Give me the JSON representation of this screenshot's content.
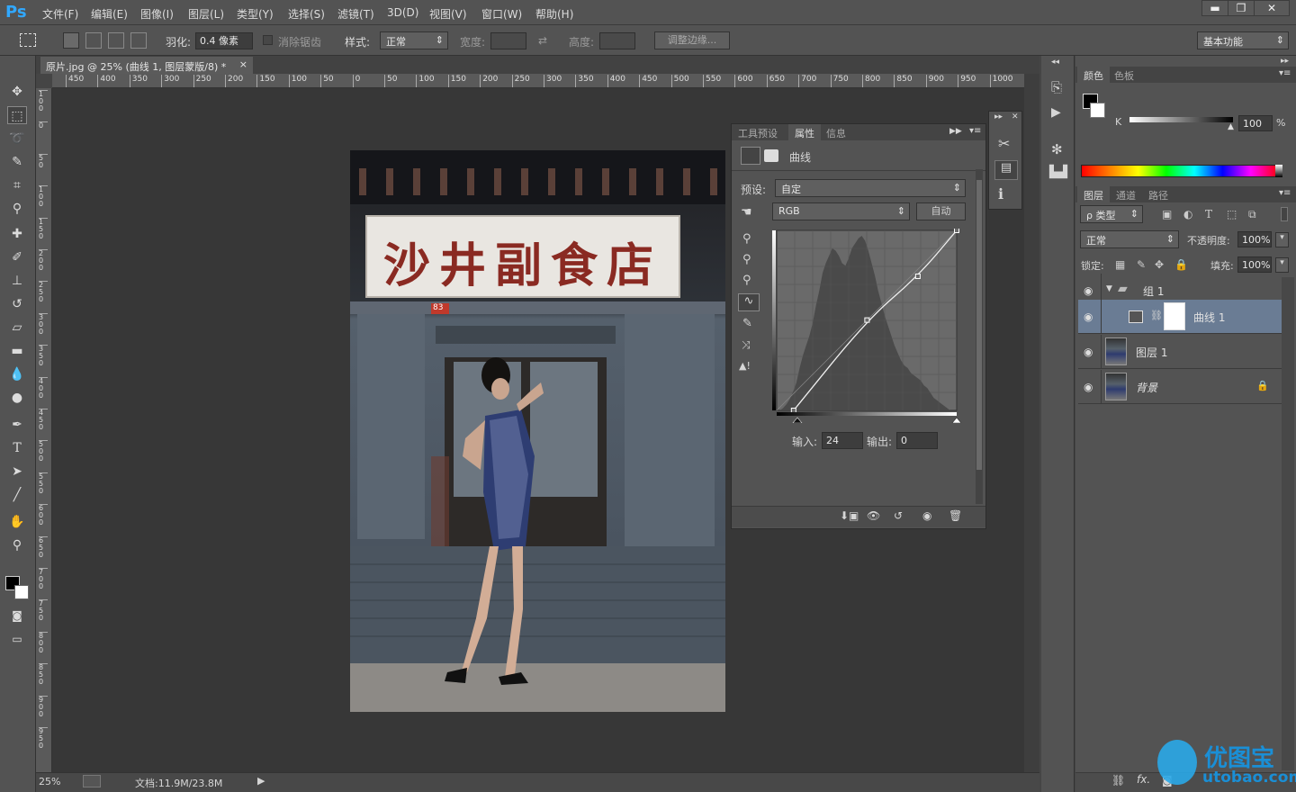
{
  "app": {
    "logo": "Ps"
  },
  "menu": [
    "文件(F)",
    "编辑(E)",
    "图像(I)",
    "图层(L)",
    "类型(Y)",
    "选择(S)",
    "滤镜(T)",
    "3D(D)",
    "视图(V)",
    "窗口(W)",
    "帮助(H)"
  ],
  "window_controls": {
    "minimize": "▬",
    "restore": "❐",
    "close": "✕"
  },
  "options": {
    "feather_label": "羽化:",
    "feather_value": "0.4 像素",
    "antialias_label": "消除锯齿",
    "style_label": "样式:",
    "style_value": "正常",
    "width_label": "宽度:",
    "height_label": "高度:",
    "refine_edge": "调整边缘...",
    "workspace": "基本功能"
  },
  "document": {
    "tab_title": "原片.jpg @ 25% (曲线 1, 图层蒙版/8) *",
    "close": "×",
    "zoom": "25%",
    "doc_size": "文档:11.9M/23.8M"
  },
  "rulers": {
    "h_ticks": [
      "450",
      "400",
      "350",
      "300",
      "250",
      "200",
      "150",
      "100",
      "50",
      "0",
      "50",
      "100",
      "150",
      "200",
      "250",
      "300",
      "350",
      "400",
      "450",
      "500",
      "550",
      "600",
      "650",
      "700",
      "750",
      "800",
      "850",
      "900",
      "950",
      "1000"
    ],
    "v_ticks": [
      "1 0 0",
      "0",
      "5 0",
      "1 0 0",
      "1 5 0",
      "2 0 0",
      "2 5 0",
      "3 0 0",
      "3 5 0",
      "4 0 0",
      "4 5 0",
      "5 0 0",
      "5 5 0",
      "6 0 0",
      "6 5 0",
      "7 0 0",
      "7 5 0",
      "8 0 0",
      "8 5 0",
      "9 0 0",
      "9 5 0"
    ]
  },
  "photo": {
    "sign_text": "沙井副食店",
    "door_number": "83"
  },
  "properties": {
    "tabs": [
      "工具预设",
      "属性",
      "信息"
    ],
    "active_tab": "属性",
    "adjustment_title": "曲线",
    "preset_label": "预设:",
    "preset_value": "自定",
    "channel": "RGB",
    "auto_button": "自动",
    "input_label": "输入:",
    "input_value": "24",
    "output_label": "输出:",
    "output_value": "0",
    "curve_points": [
      [
        24,
        0
      ],
      [
        128,
        128
      ],
      [
        200,
        190
      ],
      [
        255,
        255
      ]
    ],
    "histogram": [
      0,
      0,
      2,
      5,
      9,
      15,
      22,
      34,
      44,
      52,
      60,
      70,
      84,
      96,
      110,
      118,
      124,
      130,
      128,
      124,
      118,
      116,
      122,
      130,
      134,
      138,
      140,
      136,
      128,
      118,
      108,
      96,
      86,
      76,
      68,
      60,
      52,
      46,
      40,
      36,
      34,
      30,
      28,
      26,
      24,
      20,
      18,
      14,
      10,
      8,
      6,
      4,
      2,
      0,
      0,
      0
    ]
  },
  "color_panel": {
    "tabs": [
      "颜色",
      "色板"
    ],
    "k_label": "K",
    "k_value": "100",
    "percent": "%"
  },
  "layers_panel": {
    "tabs": [
      "图层",
      "通道",
      "路径"
    ],
    "filter_kind": "ρ 类型",
    "blend_mode": "正常",
    "opacity_label": "不透明度:",
    "opacity_value": "100%",
    "lock_label": "锁定:",
    "fill_label": "填充:",
    "fill_value": "100%",
    "layers": [
      {
        "name": "组 1"
      },
      {
        "name": "曲线 1"
      },
      {
        "name": "图层 1"
      },
      {
        "name": "背景"
      }
    ],
    "footer_fx": "fx."
  },
  "watermark": {
    "brand_cn": "优图宝",
    "brand_url": "utobao.com"
  },
  "colors": {
    "accent": "#31a8ff",
    "selected_layer": "#6a7c94",
    "panel": "#535353"
  }
}
